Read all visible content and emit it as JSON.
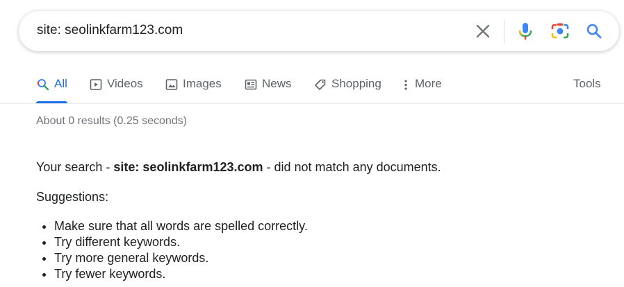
{
  "search": {
    "query": "site: seolinkfarm123.com",
    "icons": [
      "clear-icon",
      "microphone-icon",
      "camera-lens-icon",
      "search-icon"
    ]
  },
  "tabs": [
    {
      "label": "All",
      "icon": "search-icon",
      "active": true
    },
    {
      "label": "Videos",
      "icon": "video-icon"
    },
    {
      "label": "Images",
      "icon": "image-icon"
    },
    {
      "label": "News",
      "icon": "news-icon"
    },
    {
      "label": "Shopping",
      "icon": "tag-icon"
    },
    {
      "label": "More",
      "icon": "more-vert-icon"
    }
  ],
  "tools_label": "Tools",
  "stats": "About 0 results (0.25 seconds)",
  "result": {
    "prefix": "Your search - ",
    "query": "site: seolinkfarm123.com",
    "suffix": " - did not match any documents."
  },
  "suggestions": {
    "title": "Suggestions:",
    "items": [
      "Make sure that all words are spelled correctly.",
      "Try different keywords.",
      "Try more general keywords.",
      "Try fewer keywords."
    ]
  },
  "colors": {
    "accent": "#1a73e8",
    "text": "#202124",
    "muted": "#5f6368",
    "stats": "#70757a"
  }
}
